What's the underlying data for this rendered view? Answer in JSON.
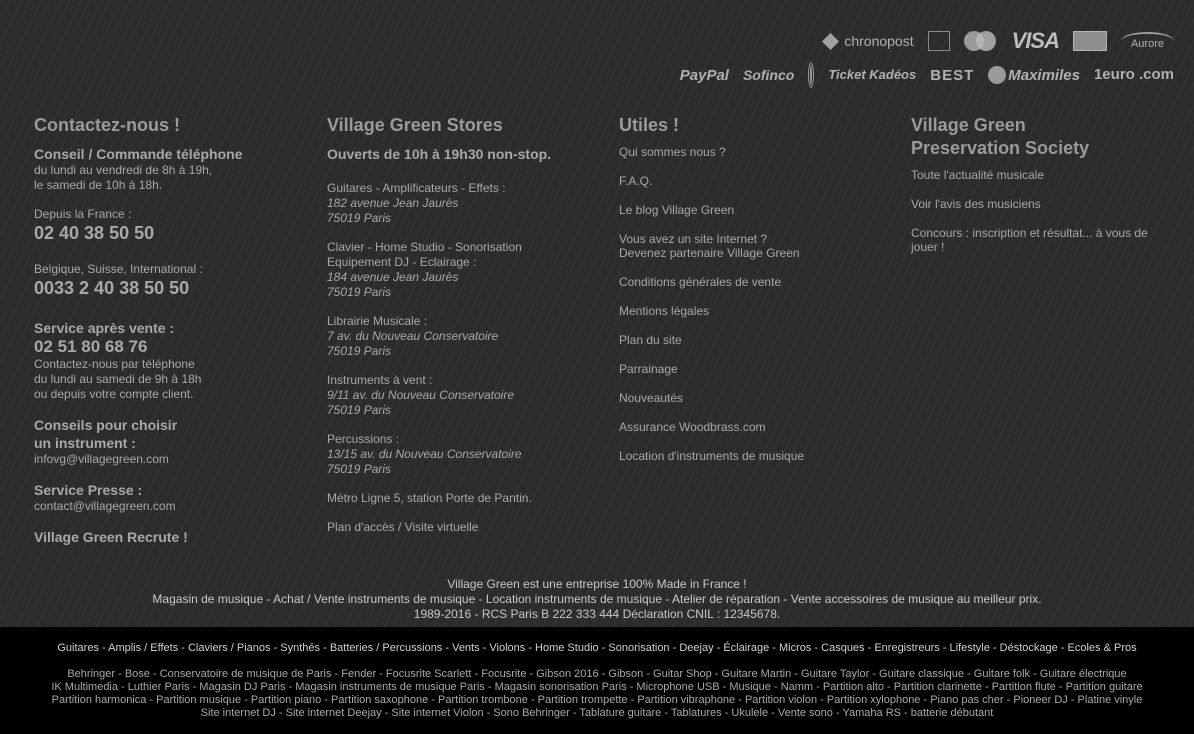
{
  "payments": {
    "row1": [
      "chronopost",
      "",
      "",
      "VISA",
      "",
      "Aurore"
    ],
    "row2": [
      "PayPal",
      "Sofinco",
      "",
      "Ticket Kadéos",
      "BEST",
      "Maximiles",
      "1euro .com"
    ]
  },
  "contact": {
    "title": "Contactez-nous !",
    "phone_order_title": "Conseil / Commande téléphone",
    "phone_order_hours_1": "du lundi au vendredi de 8h à 19h,",
    "phone_order_hours_2": "le samedi de 10h à 18h.",
    "france_label": "Depuis la France :",
    "france_phone": "02 40 38 50 50",
    "intl_label": "Belgique, Suisse, International :",
    "intl_phone": "0033 2 40 38 50 50",
    "after_sales_title": "Service après vente :",
    "after_sales_phone": "02 51 80 68 76",
    "after_sales_text_1": "Contactez-nous par téléphone",
    "after_sales_text_2": "du lundi au samedi de 9h à 18h",
    "after_sales_text_3": "ou depuis votre compte client.",
    "advice_title_1": "Conseils pour choisir",
    "advice_title_2": "un instrument :",
    "advice_email": "infovg@villagegreen.com",
    "press_title": "Service Presse :",
    "press_email": "contact@villagegreen.com",
    "recruit": "Village Green Recrute !"
  },
  "stores": {
    "title": "Village Green Stores",
    "hours": "Ouverts de 10h à 19h30 non-stop.",
    "list": [
      {
        "label": "Guitares - Amplificateurs - Effets :",
        "addr1": "182 avenue Jean Jaurès",
        "addr2": "75019 Paris"
      },
      {
        "label": "Clavier - Home Studio - Sonorisation",
        "label2": "Equipement DJ - Eclairage :",
        "addr1": "184 avenue Jean Jaurès",
        "addr2": "75019 Paris"
      },
      {
        "label": "Librairie Musicale :",
        "addr1": "7 av. du Nouveau Conservatoire",
        "addr2": "75019 Paris"
      },
      {
        "label": "Instruments à vent :",
        "addr1": "9/11 av. du Nouveau Conservatoire",
        "addr2": "75019 Paris"
      },
      {
        "label": "Percussions :",
        "addr1": "13/15 av. du Nouveau Conservatoire",
        "addr2": "75019 Paris"
      }
    ],
    "metro": "Métro Ligne 5, station Porte de Pantin.",
    "plan": "Plan d'accès / Visite virtuelle"
  },
  "utiles": {
    "title": "Utiles !",
    "links": [
      "Qui sommes nous ?",
      "F.A.Q.",
      "Le blog Village Green",
      "Vous avez un site Internet ?",
      "Conditions générales de vente",
      "Mentions légales",
      "Plan du site",
      "Parrainage",
      "Nouveautés",
      "Assurance Woodbrass.com",
      "Location d'instruments de musique"
    ],
    "partner_line2": "Devenez partenaire Village Green"
  },
  "society": {
    "title_1": "Village Green",
    "title_2": "Preservation Society",
    "links": [
      "Toute l'actualité musicale",
      "Voir l'avis des musiciens",
      "Concours : inscription et résultat... à vous de jouer !"
    ]
  },
  "legal": {
    "line1": "Village Green est une entreprise 100% Made in France !",
    "line2": "Magasin de musique - Achat / Vente instruments de musique - Location instruments de musique - Atelier de réparation - Vente accessoires de musique au meilleur prix.",
    "line3": "1989-2016 - RCS Paris B 222 333 444 Déclaration CNIL : 12345678."
  },
  "categories": "Guitares - Amplis / Effets - Claviers / Pianos - Synthés - Batteries / Percussions - Vents - Violons - Home Studio - Sonorisation - Deejay - Éclairage - Micros - Casques - Enregistreurs - Lifestyle - Déstockage - Ecoles & Pros",
  "keywords": {
    "line1": "Behringer - Bose - Conservatoire de musique de Paris - Fender - Focusrite Scarlett - Focusrite - Gibson 2016 - Gibson - Guitar Shop - Guitare Martin - Guitare Taylor - Guitare classique - Guitare folk - Guitare électrique",
    "line2": "IK Multimedia - Luthier Paris - Magasin DJ Paris - Magasin instruments de musique Paris - Magasin sonorisation Paris - Microphone USB - Musique - Namm - Partition alto - Partition clarinette - Partition flute - Partition guitare",
    "line3": "Partition harmonica - Partition musique - Partition piano - Partition saxophone - Partition trombone - Partition trompette - Partition vibraphone - Partition violon - Partition xylophone - Piano pas cher - Pioneer DJ - Platine vinyle",
    "line4": "Site internet DJ - Site internet Deejay - Site internet Violon - Sono Behringer - Tablature guitare - Tablatures - Ukulele - Vente sono - Yamaha RS - batterie débutant"
  }
}
